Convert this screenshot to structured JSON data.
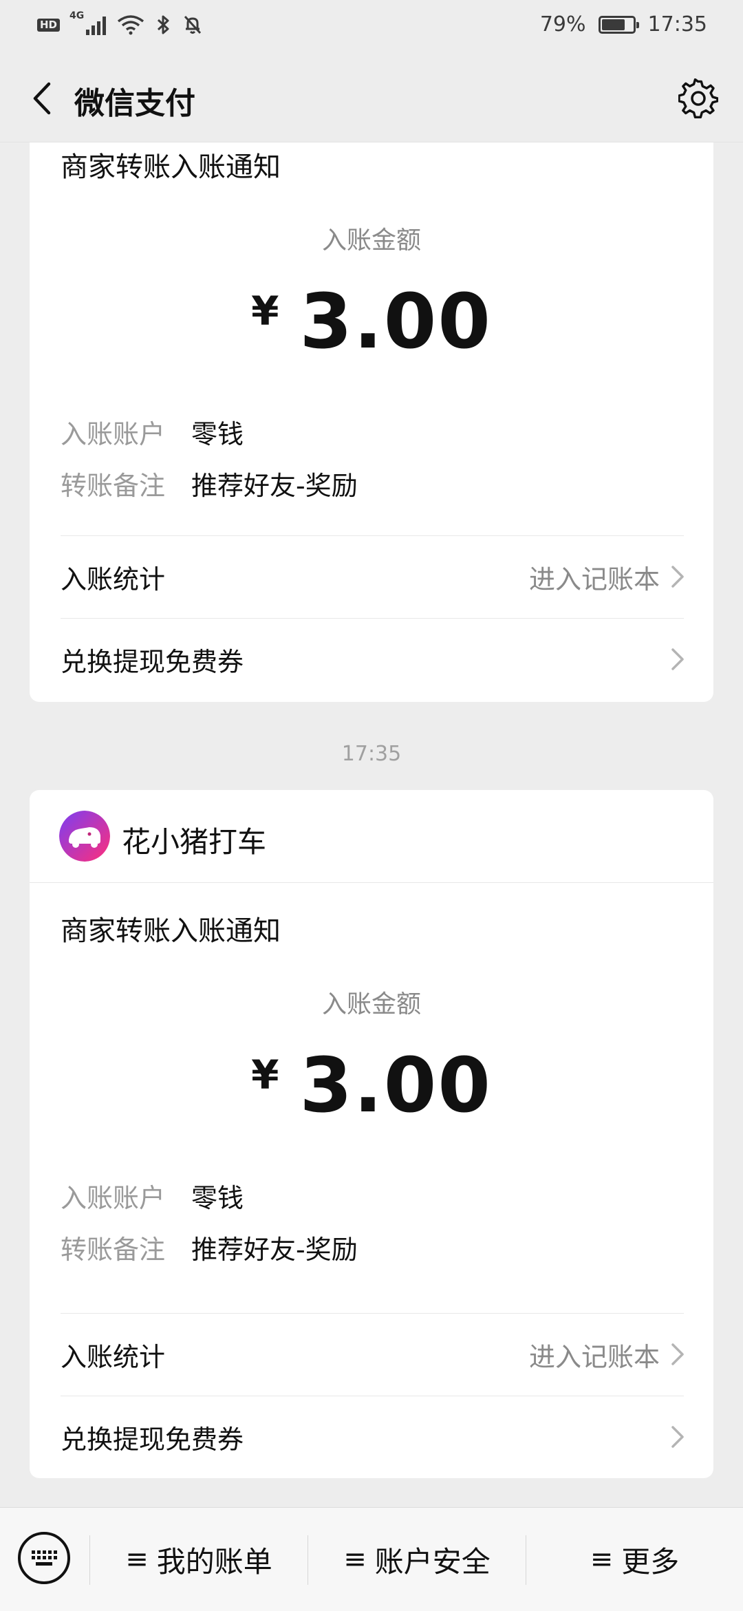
{
  "status_bar": {
    "hd": "HD",
    "network": "4G",
    "battery_percent_text": "79%",
    "battery_level": 0.79,
    "time": "17:35"
  },
  "header": {
    "title": "微信支付"
  },
  "cards": [
    {
      "notice_title": "商家转账入账通知",
      "amount_label": "入账金额",
      "currency": "¥",
      "amount": "3.00",
      "account_label": "入账账户",
      "account_value": "零钱",
      "remark_label": "转账备注",
      "remark_value": "推荐好友-奖励",
      "stats_label": "入账统计",
      "stats_hint": "进入记账本",
      "coupon_label": "兑换提现免费券"
    },
    {
      "brand_name": "花小猪打车",
      "notice_title": "商家转账入账通知",
      "amount_label": "入账金额",
      "currency": "¥",
      "amount": "3.00",
      "account_label": "入账账户",
      "account_value": "零钱",
      "remark_label": "转账备注",
      "remark_value": "推荐好友-奖励",
      "stats_label": "入账统计",
      "stats_hint": "进入记账本",
      "coupon_label": "兑换提现免费券"
    }
  ],
  "timestamp": "17:35",
  "bottom_bar": {
    "menu_glyph": "≡",
    "bills_label": "我的账单",
    "security_label": "账户安全",
    "more_label": "更多"
  },
  "colors": {
    "background": "#ededed",
    "card": "#ffffff",
    "secondary_text": "#8a8a8a",
    "brand_gradient_start": "#7b3ff2",
    "brand_gradient_end": "#ff2e7a"
  }
}
